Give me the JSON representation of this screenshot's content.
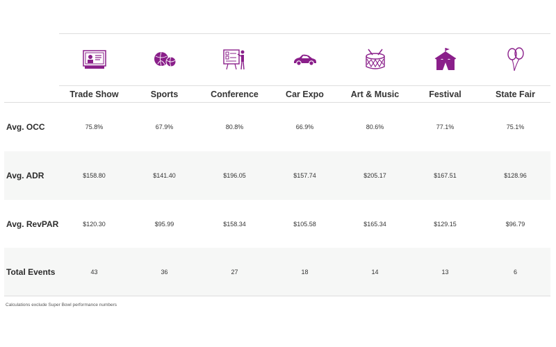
{
  "accent_color": "#8a1f8a",
  "columns": [
    {
      "label": "Trade Show",
      "icon": "trade-show-booth-icon"
    },
    {
      "label": "Sports",
      "icon": "sports-balls-icon"
    },
    {
      "label": "Conference",
      "icon": "conference-presenter-icon"
    },
    {
      "label": "Car Expo",
      "icon": "car-icon"
    },
    {
      "label": "Art & Music",
      "icon": "drum-icon"
    },
    {
      "label": "Festival",
      "icon": "circus-tent-icon"
    },
    {
      "label": "State Fair",
      "icon": "balloons-icon"
    }
  ],
  "rows": [
    {
      "label": "Avg. OCC",
      "values": [
        "75.8%",
        "67.9%",
        "80.8%",
        "66.9%",
        "80.6%",
        "77.1%",
        "75.1%"
      ]
    },
    {
      "label": "Avg. ADR",
      "values": [
        "$158.80",
        "$141.40",
        "$196.05",
        "$157.74",
        "$205.17",
        "$167.51",
        "$128.96"
      ]
    },
    {
      "label": "Avg. RevPAR",
      "values": [
        "$120.30",
        "$95.99",
        "$158.34",
        "$105.58",
        "$165.34",
        "$129.15",
        "$96.79"
      ]
    },
    {
      "label": "Total Events",
      "values": [
        "43",
        "36",
        "27",
        "18",
        "14",
        "13",
        "6"
      ]
    }
  ],
  "footnote": "Calculations exclude Super Bowl performance numbers"
}
